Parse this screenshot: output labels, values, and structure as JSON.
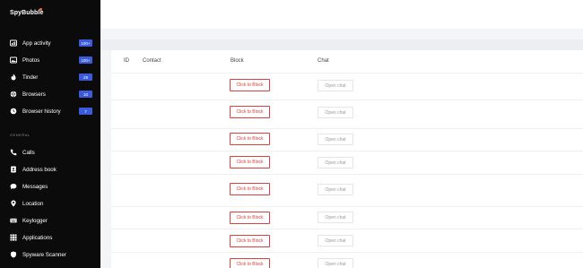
{
  "app": {
    "logo": "SpyBubble",
    "accent": "#ff6a3d"
  },
  "sidebar": {
    "items": [
      {
        "label": "App activity",
        "badge": "100+",
        "badge_color": "#3b5bdb",
        "icon": "bar-chart-icon"
      },
      {
        "label": "Photos",
        "badge": "100+",
        "badge_color": "#3b5bdb",
        "icon": "image-icon"
      },
      {
        "label": "Tinder",
        "badge": "29",
        "badge_color": "#3b5bdb",
        "icon": "flame-icon"
      },
      {
        "label": "Browsers",
        "badge": "10",
        "badge_color": "#3b5bdb",
        "icon": "globe-icon"
      },
      {
        "label": "Browser history",
        "badge": "7",
        "badge_color": "#3b5bdb",
        "icon": "globe-clock-icon"
      }
    ],
    "section_label": "GENERAL",
    "general_items": [
      {
        "label": "Calls",
        "icon": "phone-icon"
      },
      {
        "label": "Address book",
        "icon": "contact-book-icon"
      },
      {
        "label": "Messages",
        "icon": "chat-bubble-icon"
      },
      {
        "label": "Location",
        "icon": "location-pin-icon"
      },
      {
        "label": "Keylogger",
        "icon": "keyboard-icon"
      },
      {
        "label": "Applications",
        "icon": "grid-icon"
      },
      {
        "label": "Spyware Scanner",
        "icon": "shield-icon"
      }
    ]
  },
  "table": {
    "headers": {
      "id": "ID",
      "contact": "Contact",
      "block": "Block",
      "chat": "Chat"
    },
    "rows": [
      {
        "block_label": "Click to Block",
        "chat_label": "Open chat"
      },
      {
        "block_label": "Click to Block",
        "chat_label": "Open chat"
      },
      {
        "block_label": "Click to Block",
        "chat_label": "Open chat"
      },
      {
        "block_label": "Click to Block",
        "chat_label": "Open chat"
      },
      {
        "block_label": "Click to Block",
        "chat_label": "Open chat"
      },
      {
        "block_label": "Click to Block",
        "chat_label": "Open chat"
      },
      {
        "block_label": "Click to Block",
        "chat_label": "Open chat"
      },
      {
        "block_label": "Click to Block",
        "chat_label": "Open chat"
      }
    ]
  }
}
